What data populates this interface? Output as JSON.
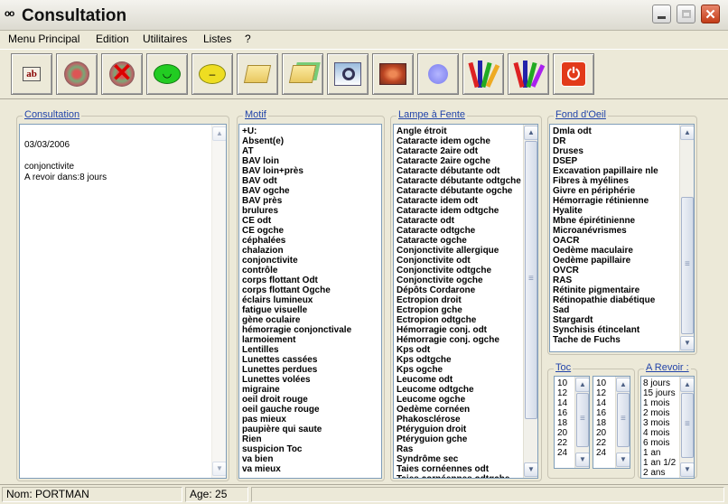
{
  "window": {
    "title": "Consultation"
  },
  "menu": [
    "Menu Principal",
    "Edition",
    "Utilitaires",
    "Listes",
    "?"
  ],
  "toolbar_icons": [
    "text-ab-icon",
    "stamp-icon",
    "cancel-stamp-icon",
    "green-smiley-icon",
    "yellow-smiley-icon",
    "open-folder-icon",
    "open-folder-2-icon",
    "magnifier-icon",
    "photo-icon",
    "blue-dot-icon",
    "pencils-icon",
    "pencils-2-icon",
    "power-icon"
  ],
  "colors": {
    "accent": "#2244aa",
    "close": "#c33c17",
    "green": "#22cc22",
    "yellow": "#eedd22"
  },
  "consultation": {
    "label": "Consultation",
    "date": "03/03/2006",
    "line1": "conjonctivite",
    "line2": "A revoir dans:8 jours"
  },
  "motif": {
    "label": "Motif",
    "items": [
      "+U:",
      "Absent(e)",
      "AT",
      "BAV loin",
      "BAV loin+près",
      "BAV odt",
      "BAV ogche",
      "BAV près",
      "brulures",
      "CE odt",
      "CE ogche",
      "céphalées",
      "chalazion",
      "conjonctivite",
      "contrôle",
      "corps flottant Odt",
      "corps flottant Ogche",
      "éclairs lumineux",
      "fatigue visuelle",
      "gène oculaire",
      "hémorragie conjonctivale",
      "larmoiement",
      "Lentilles",
      "Lunettes cassées",
      "Lunettes perdues",
      "Lunettes volées",
      "migraine",
      "oeil droit rouge",
      "oeil gauche rouge",
      "pas mieux",
      "paupière qui saute",
      "Rien",
      "suspicion Toc",
      "va bien",
      "va mieux"
    ]
  },
  "lampe": {
    "label": "Lampe à Fente",
    "items": [
      "Angle étroit",
      "Cataracte idem ogche",
      "Cataracte 2aire odt",
      "Cataracte 2aire ogche",
      "Cataracte débutante odt",
      "Cataracte débutante odtgche",
      "Cataracte débutante ogche",
      "Cataracte idem odt",
      "Cataracte idem odtgche",
      "Cataracte odt",
      "Cataracte odtgche",
      "Cataracte ogche",
      "Conjonctivite allergique",
      "Conjonctivite odt",
      "Conjonctivite odtgche",
      "Conjonctivite ogche",
      "Dépôts Cordarone",
      "Ectropion droit",
      "Ectropion gche",
      "Ectropion odtgche",
      "Hémorragie conj. odt",
      "Hémorragie conj. ogche",
      "Kps odt",
      "Kps odtgche",
      "Kps ogche",
      "Leucome odt",
      "Leucome odtgche",
      "Leucome ogche",
      "Oedème cornéen",
      "Phakosclérose",
      "Ptéryguion droit",
      "Ptéryguion gche",
      "Ras",
      "Syndrôme sec",
      "Taies cornéennes odt",
      "Taies cornéennes odtgche"
    ]
  },
  "fond": {
    "label": "Fond d'Oeil",
    "items": [
      "Dmla odt",
      "DR",
      "Druses",
      "DSEP",
      "Excavation papillaire nle",
      "Fibres à myélines",
      "Givre en périphérie",
      "Hémorragie rétinienne",
      "Hyalite",
      "Mbne épirétinienne",
      "Microanévrismes",
      "OACR",
      "Oedème maculaire",
      "Oedème papillaire",
      "OVCR",
      "RAS",
      "Rétinite pigmentaire",
      "Rétinopathie diabétique",
      "Sad",
      "Stargardt",
      "Synchisis étincelant",
      "Tache de Fuchs"
    ]
  },
  "toc": {
    "label": "Toc",
    "left": [
      "10",
      "12",
      "14",
      "16",
      "18",
      "20",
      "22",
      "24"
    ],
    "right": [
      "10",
      "12",
      "14",
      "16",
      "18",
      "20",
      "22",
      "24"
    ]
  },
  "revoir": {
    "label": "A Revoir :",
    "items": [
      "8 jours",
      "15 jours",
      "1 mois",
      "2 mois",
      "3 mois",
      "4 mois",
      "6 mois",
      "1 an",
      "1 an 1/2",
      "2 ans"
    ]
  },
  "status": {
    "nom": "Nom: PORTMAN",
    "age": "Age: 25"
  }
}
